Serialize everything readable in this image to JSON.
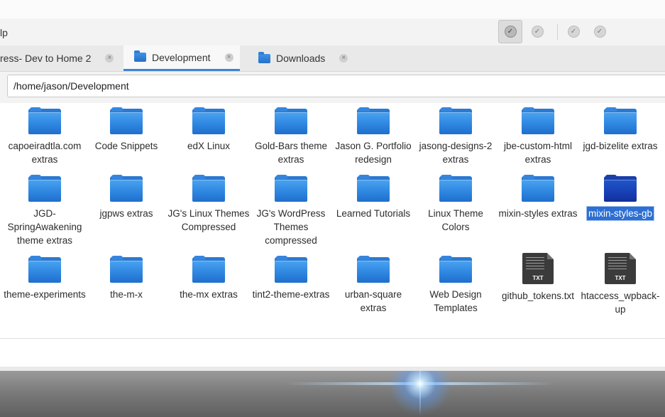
{
  "menubar": {
    "partial_menu": "lp"
  },
  "toolbar": {
    "buttons": [
      {
        "icon": "check-circle-icon",
        "pressed": true
      },
      {
        "icon": "check-circle-icon",
        "pressed": false
      },
      {
        "icon": "check-circle-icon",
        "pressed": false
      },
      {
        "icon": "check-circle-icon",
        "pressed": false
      }
    ]
  },
  "tabs": [
    {
      "label": "ress- Dev to Home 2",
      "active": false,
      "has_icon": false
    },
    {
      "label": "Development",
      "active": true,
      "has_icon": true
    },
    {
      "label": "Downloads",
      "active": false,
      "has_icon": true
    }
  ],
  "location": {
    "path": "/home/jason/Development"
  },
  "items": [
    {
      "name": "capoeiradtla.com extras",
      "type": "folder"
    },
    {
      "name": "Code Snippets",
      "type": "folder"
    },
    {
      "name": "edX Linux",
      "type": "folder"
    },
    {
      "name": "Gold-Bars theme extras",
      "type": "folder"
    },
    {
      "name": "Jason G. Portfolio redesign",
      "type": "folder"
    },
    {
      "name": "jasong-designs-2 extras",
      "type": "folder"
    },
    {
      "name": "jbe-custom-html extras",
      "type": "folder"
    },
    {
      "name": "jgd-bizelite extras",
      "type": "folder"
    },
    {
      "name": "JGD-SpringAwakening theme extras",
      "type": "folder"
    },
    {
      "name": "jgpws extras",
      "type": "folder"
    },
    {
      "name": "JG's Linux Themes Compressed",
      "type": "folder"
    },
    {
      "name": "JG's WordPress Themes compressed",
      "type": "folder"
    },
    {
      "name": "Learned Tutorials",
      "type": "folder"
    },
    {
      "name": "Linux Theme Colors",
      "type": "folder"
    },
    {
      "name": "mixin-styles extras",
      "type": "folder"
    },
    {
      "name": "mixin-styles-gb",
      "type": "folder",
      "selected": true
    },
    {
      "name": "theme-experiments",
      "type": "folder"
    },
    {
      "name": "the-m-x",
      "type": "folder"
    },
    {
      "name": "the-mx extras",
      "type": "folder"
    },
    {
      "name": "tint2-theme-extras",
      "type": "folder"
    },
    {
      "name": "urban-square extras",
      "type": "folder"
    },
    {
      "name": "Web Design Templates",
      "type": "folder"
    },
    {
      "name": "github_tokens.txt",
      "type": "text-file",
      "badge": "TXT"
    },
    {
      "name": "htaccess_wpback-up",
      "type": "text-file",
      "badge": "TXT"
    }
  ],
  "colors": {
    "accent": "#3f85d3",
    "selection": "#2d6fd2",
    "folder": "#2e86e0",
    "folder_selected": "#173fb3"
  }
}
